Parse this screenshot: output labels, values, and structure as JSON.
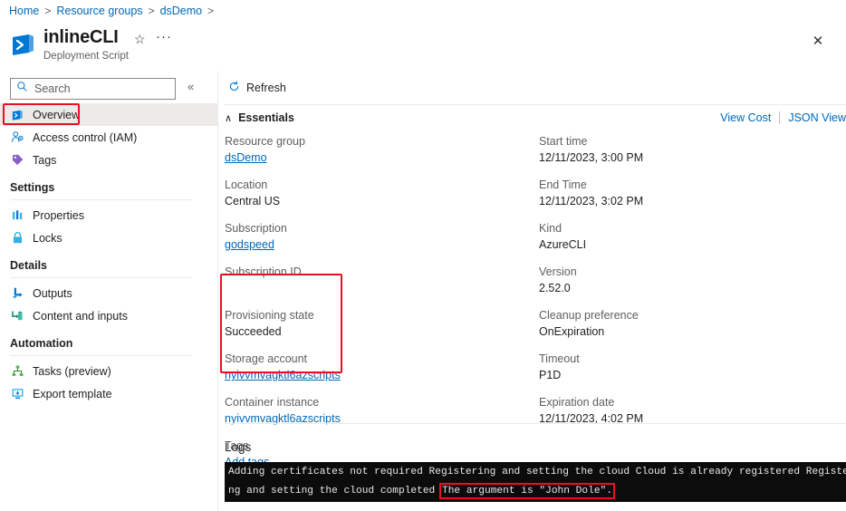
{
  "breadcrumb": {
    "items": [
      {
        "label": "Home"
      },
      {
        "label": "Resource groups"
      },
      {
        "label": "dsDemo"
      }
    ],
    "separator": ">"
  },
  "header": {
    "title": "inlineCLI",
    "subtitle": "Deployment Script",
    "icon": "deployment-script-icon",
    "star_icon": "☆",
    "ellipsis": "···",
    "close_icon": "✕"
  },
  "search": {
    "placeholder": "Search",
    "value": "",
    "icon": "search-icon",
    "collapse_icon": "«"
  },
  "sidebar": {
    "items": [
      {
        "label": "Overview",
        "icon": "deployment-script-icon",
        "selected": true,
        "highlighted": true
      },
      {
        "label": "Access control (IAM)",
        "icon": "access-control-icon",
        "selected": false
      },
      {
        "label": "Tags",
        "icon": "tag-icon",
        "selected": false
      }
    ],
    "sections": [
      {
        "title": "Settings",
        "items": [
          {
            "label": "Properties",
            "icon": "properties-icon"
          },
          {
            "label": "Locks",
            "icon": "lock-icon"
          }
        ]
      },
      {
        "title": "Details",
        "items": [
          {
            "label": "Outputs",
            "icon": "outputs-icon"
          },
          {
            "label": "Content and inputs",
            "icon": "content-inputs-icon"
          }
        ]
      },
      {
        "title": "Automation",
        "items": [
          {
            "label": "Tasks (preview)",
            "icon": "tasks-icon"
          },
          {
            "label": "Export template",
            "icon": "export-template-icon"
          }
        ]
      }
    ]
  },
  "toolbar": {
    "refresh_label": "Refresh",
    "refresh_icon": "refresh-icon"
  },
  "essentials": {
    "title": "Essentials",
    "collapse_icon": "∧",
    "view_cost_label": "View Cost",
    "json_view_label": "JSON View",
    "left_fields": [
      {
        "label": "Resource group",
        "value": "dsDemo",
        "is_link": true
      },
      {
        "label": "Location",
        "value": "Central US",
        "is_link": false
      },
      {
        "label": "Subscription",
        "value": "godspeed",
        "is_link": true
      },
      {
        "label": "Subscription ID",
        "value": "",
        "is_link": false
      },
      {
        "label": "Provisioning state",
        "value": "Succeeded",
        "is_link": false
      },
      {
        "label": "Storage account",
        "value": "nyivvmvagktl6azscripts",
        "is_link": true
      },
      {
        "label": "Container instance",
        "value": "nyivvmvagktl6azscripts",
        "is_link": true
      }
    ],
    "right_fields": [
      {
        "label": "Start time",
        "value": "12/11/2023, 3:00 PM",
        "is_link": false
      },
      {
        "label": "End Time",
        "value": "12/11/2023, 3:02 PM",
        "is_link": false
      },
      {
        "label": "Kind",
        "value": "AzureCLI",
        "is_link": false
      },
      {
        "label": "Version",
        "value": "2.52.0",
        "is_link": false
      },
      {
        "label": "Cleanup preference",
        "value": "OnExpiration",
        "is_link": false
      },
      {
        "label": "Timeout",
        "value": "P1D",
        "is_link": false
      },
      {
        "label": "Expiration date",
        "value": "12/11/2023, 4:02 PM",
        "is_link": false
      }
    ],
    "tags": {
      "label": "Tags",
      "value": "Add tags"
    }
  },
  "logs": {
    "title": "Logs",
    "line1": "Adding certificates not required Registering and setting the cloud Cloud is already registered Registeri",
    "line2_prefix": "ng and setting the cloud completed ",
    "line2_highlight": "The argument is \"John Dole\"."
  },
  "colors": {
    "accent": "#0078d4",
    "link": "#0067b8",
    "highlight": "#e81123",
    "console_bg": "#0c0c0c"
  }
}
